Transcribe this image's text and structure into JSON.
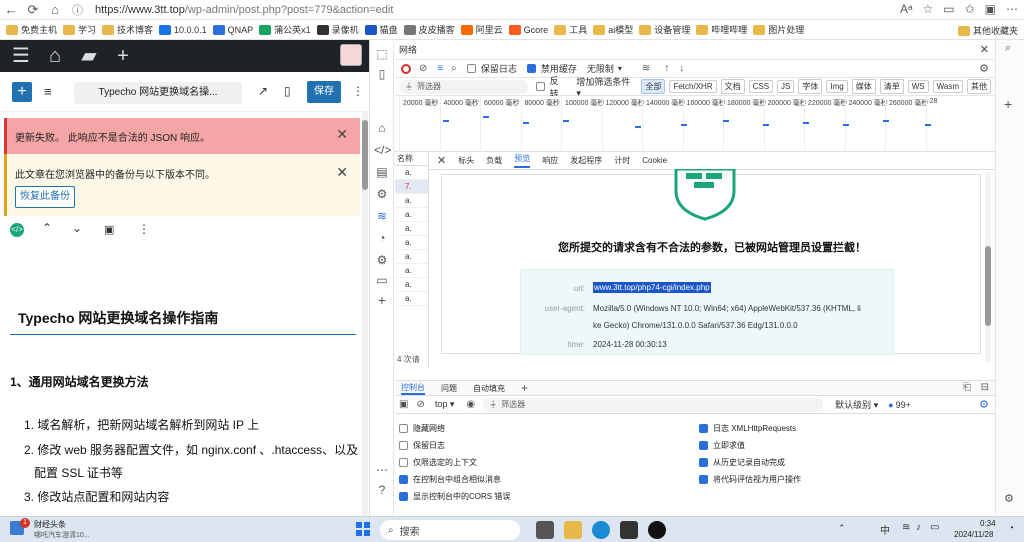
{
  "browser": {
    "url_host": "https://www.3tt.top",
    "url_path": "/wp-admin/post.php?post=779&action=edit"
  },
  "bookmarks": [
    {
      "label": "免费主机",
      "color": "#e8b84a"
    },
    {
      "label": "学习",
      "color": "#e8b84a"
    },
    {
      "label": "技术博客",
      "color": "#e8b84a"
    },
    {
      "label": "10.0.0.1",
      "color": "#1a73e8"
    },
    {
      "label": "QNAP",
      "color": "#2a6fdb"
    },
    {
      "label": "蒲公英x1",
      "color": "#1aa260"
    },
    {
      "label": "录像机",
      "color": "#333333"
    },
    {
      "label": "猫盘",
      "color": "#1a56c8"
    },
    {
      "label": "皮皮播客",
      "color": "#777777"
    },
    {
      "label": "阿里云",
      "color": "#ff6a00"
    },
    {
      "label": "Gcore",
      "color": "#ff5a1f"
    },
    {
      "label": "工具",
      "color": "#e8b84a"
    },
    {
      "label": "ai模型",
      "color": "#e8b84a"
    },
    {
      "label": "设备管理",
      "color": "#e8b84a"
    },
    {
      "label": "哔哩哔哩",
      "color": "#e8b84a"
    },
    {
      "label": "图片处理",
      "color": "#e8b84a"
    }
  ],
  "bookmarks_other": "其他收藏夹",
  "editor": {
    "doc_title": "Typecho 网站更换域名操...",
    "save_label": "保存",
    "notice_error": "更新失败。 此响应不是合法的 JSON 响应。",
    "notice_backup": "此文章在您浏览器中的备份与以下版本不同。",
    "restore_label": "恢复此备份",
    "heading": "Typecho 网站更换域名操作指南",
    "section1": "1、通用网站域名更换方法",
    "list": [
      "1. 域名解析，把新网站域名解析到网站 IP 上",
      "2. 修改 web 服务器配置文件，如 nginx.conf 、.htaccess、以及",
      "配置 SSL 证书等",
      "3. 修改站点配置和网站内容"
    ]
  },
  "devtools": {
    "panel_title": "网络",
    "toolbar": {
      "preserve_log": "保留日志",
      "disable_cache": "禁用缓存",
      "throttle": "无限制",
      "filter_placeholder": "筛选器",
      "invert": "反转",
      "more_filters": "增加筛选条件 ▾"
    },
    "type_filters": [
      "全部",
      "Fetch/XHR",
      "文档",
      "CSS",
      "JS",
      "字体",
      "Img",
      "媒体",
      "清单",
      "WS",
      "Wasm",
      "其他"
    ],
    "timeline_ticks": [
      "20000 毫秒",
      "40000 毫秒",
      "60000 毫秒",
      "80000 毫秒",
      "100000 毫秒",
      "120000 毫秒",
      "140000 毫秒",
      "160000 毫秒",
      "180000 毫秒",
      "200000 毫秒",
      "220000 毫秒",
      "240000 毫秒",
      "260000 毫秒",
      "28"
    ],
    "request_list": {
      "header": "名称",
      "rows": [
        "a.",
        "7.",
        "a.",
        "a.",
        "a.",
        "a.",
        "a.",
        "a.",
        "a.",
        "a."
      ],
      "footer": "4 次请"
    },
    "detail_tabs": [
      "标头",
      "负载",
      "预览",
      "响应",
      "发起程序",
      "计时",
      "Cookie"
    ],
    "preview": {
      "blocked_message": "您所提交的请求含有不合法的参数，已被网站管理员设置拦截！",
      "url_label": "url:",
      "url_value": "www.3tt.top/php74-cgi/index.php",
      "ua_label": "user-agent:",
      "ua_value_1": "Mozilla/5.0 (Windows NT 10.0; Win64; x64) AppleWebKit/537.36 (KHTML, li",
      "ua_value_2": "ke Gecko) Chrome/131.0.0.0 Safari/537.36 Edg/131.0.0.0",
      "time_label": "time:",
      "time_value": "2024-11-28 00:30:13"
    },
    "console_tabs": [
      "控制台",
      "问题",
      "自动填充"
    ],
    "console_bar": {
      "context": "top ▾",
      "filter_placeholder": "筛选器",
      "level": "默认级别 ▾",
      "issues": "99+"
    },
    "settings_left": [
      {
        "label": "隐藏网络",
        "on": false
      },
      {
        "label": "保留日志",
        "on": false
      },
      {
        "label": "仅限选定的上下文",
        "on": false
      },
      {
        "label": "在控制台中组合相似消息",
        "on": true
      },
      {
        "label": "显示控制台中的CORS 错误",
        "on": true
      }
    ],
    "settings_right": [
      {
        "label": "日志 XMLHttpRequests",
        "on": true
      },
      {
        "label": "立即求值",
        "on": true
      },
      {
        "label": "从历史记录自动完成",
        "on": true
      },
      {
        "label": "将代码评估视为用户操作",
        "on": true
      }
    ]
  },
  "taskbar": {
    "news_title": "财经头条",
    "news_sub": "哪吒汽车澄清10...",
    "badge": "1",
    "search_placeholder": "搜索",
    "ime": "中",
    "time": "0:34",
    "date": "2024/11/28"
  },
  "colors": {
    "wp_dark": "#1d2327",
    "wp_blue": "#2271b1",
    "error_bg": "#f4a5a5",
    "warning_bg": "#fdf7e8",
    "shield_green": "#1aa57a",
    "devtools_blue": "#2a6fdb"
  }
}
